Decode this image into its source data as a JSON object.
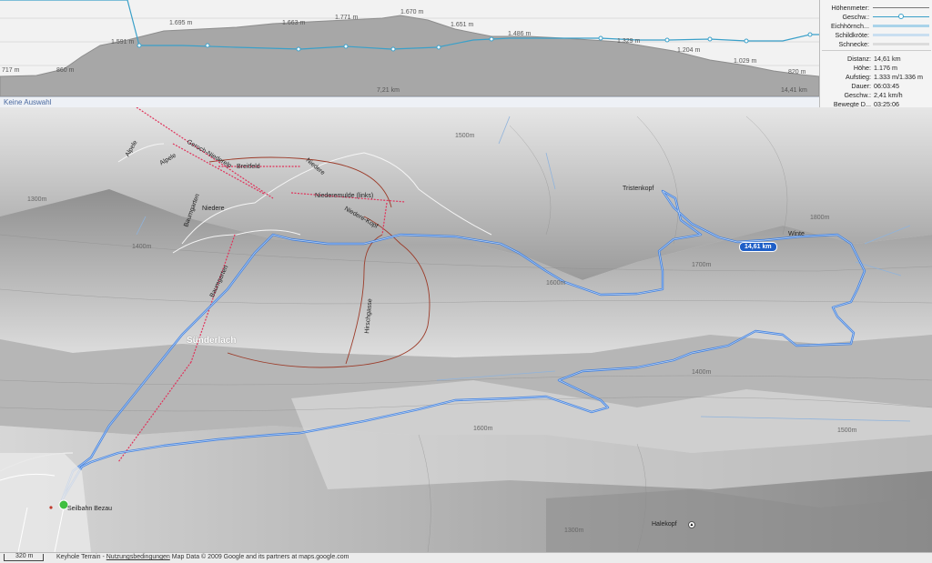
{
  "profile": {
    "elevation_labels": [
      "717 m",
      "860 m",
      "1.591 m",
      "1.695 m",
      "1.663 m",
      "1.771 m",
      "1.670 m",
      "1.651 m",
      "1.486 m",
      "1.329 m",
      "1.204 m",
      "1.029 m",
      "820 m"
    ],
    "distance_labels": [
      "7,21 km",
      "14,41 km"
    ]
  },
  "legend": {
    "items": [
      {
        "label": "Höhenmeter:",
        "color": "#777777"
      },
      {
        "label": "Geschw.:",
        "color": "#3aa0c9"
      },
      {
        "label": "Eichhörnch...",
        "color": "#a9d3ea"
      },
      {
        "label": "Schildkröte:",
        "color": "#c9def0"
      },
      {
        "label": "Schnecke:",
        "color": "#cccccc"
      }
    ]
  },
  "stats": {
    "rows": [
      {
        "label": "Distanz:",
        "value": "14,61 km"
      },
      {
        "label": "Höhe:",
        "value": "1.176 m"
      },
      {
        "label": "Aufstieg:",
        "value": "1.333 m/1.336 m"
      },
      {
        "label": "Dauer:",
        "value": "06:03:45"
      },
      {
        "label": "Geschw.:",
        "value": "2,41 km/h"
      },
      {
        "label": "Bewegte D...",
        "value": "03:25:06"
      }
    ]
  },
  "selection": {
    "text": "Keine Auswahl"
  },
  "map": {
    "distance_badge": "14,61 km",
    "labels": [
      "Alpele",
      "Alpele",
      "Geroch-Niederelp",
      "Breitfeld",
      "Niedere",
      "Niederemulde (links)",
      "Baumgarten",
      "Niedere",
      "Niedere-Kopf",
      "Tristenkopf",
      "Winte",
      "Baumgarten",
      "Hirschgasse",
      "Sünderlach",
      "Seilbahn Bezau",
      "Halekopf"
    ],
    "contour_labels": [
      "1300m",
      "1400m",
      "1500m",
      "1600m",
      "1700m",
      "1800m",
      "1400m",
      "1500m",
      "1600m",
      "1300m"
    ],
    "colors": {
      "track": "#3b7de0",
      "ski": "#e0325a",
      "trail": "#9c3c2a"
    }
  },
  "footer": {
    "scale": "320 m",
    "terrain": "Keyhole Terrain",
    "separator": " - ",
    "terms": "Nutzungsbedingungen",
    "copyright": " Map Data © 2009 Google and its partners at maps.google.com"
  }
}
